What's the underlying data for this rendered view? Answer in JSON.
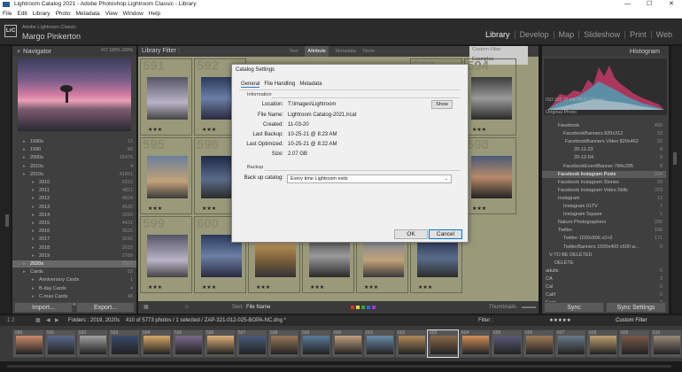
{
  "window": {
    "title": "Lightroom Catalog 2021 - Adobe Photoshop Lightroom Classic - Library",
    "minimize": "—",
    "maximize": "☐",
    "close": "✕"
  },
  "menu": [
    "File",
    "Edit",
    "Library",
    "Photo",
    "Metadata",
    "View",
    "Window",
    "Help"
  ],
  "identity": {
    "logo": "LrC",
    "app": "Adobe Lightroom Classic",
    "user": "Margo Pinkerton"
  },
  "modules": [
    "Library",
    "Develop",
    "Map",
    "Slideshow",
    "Print",
    "Web"
  ],
  "active_module": "Library",
  "navigator": {
    "title": "Navigator",
    "zoom": "FIT  100%  200%"
  },
  "folders": [
    {
      "label": "1990s",
      "count": "12"
    },
    {
      "label": "1990",
      "count": "80"
    },
    {
      "label": "2000s",
      "count": "15476"
    },
    {
      "label": "2010s",
      "count": "4"
    },
    {
      "label": "2010s",
      "count": "41691"
    },
    {
      "label": "2010",
      "count": "6313"
    },
    {
      "label": "2011",
      "count": "4811"
    },
    {
      "label": "2012",
      "count": "4824"
    },
    {
      "label": "2013",
      "count": "4530"
    },
    {
      "label": "2014",
      "count": "3260"
    },
    {
      "label": "2015",
      "count": "4431"
    },
    {
      "label": "2016",
      "count": "3625"
    },
    {
      "label": "2017",
      "count": "3242"
    },
    {
      "label": "2018",
      "count": "2615"
    },
    {
      "label": "2019",
      "count": "2780"
    },
    {
      "label": "2020s",
      "count": "2993"
    },
    {
      "label": "Cards",
      "count": "53"
    },
    {
      "label": "Anniversary Cards",
      "count": "1"
    },
    {
      "label": "B-day Cards",
      "count": "4"
    },
    {
      "label": "C-mas Cards",
      "count": "48"
    },
    {
      "label": "Combo for Social Media",
      "count": "297"
    }
  ],
  "left_buttons": {
    "import": "Import...",
    "export": "Export..."
  },
  "library_filter": {
    "label": "Library Filter :",
    "tabs": [
      "Text",
      "Attribute",
      "Metadata",
      "None"
    ],
    "active": "Attribute"
  },
  "examples": {
    "top": "Custom Filter",
    "value": "Examples"
  },
  "grid": [
    {
      "num": "591",
      "stars": "★★★"
    },
    {
      "num": "592",
      "stars": "★★★"
    },
    {
      "num": "593",
      "stars": "★★★"
    },
    {
      "num": "594",
      "stars": "★★★"
    },
    {
      "num": "595",
      "stars": "★★★"
    },
    {
      "num": "596",
      "stars": "★★★"
    },
    {
      "num": "597",
      "stars": "★★★"
    },
    {
      "num": "598",
      "stars": "★★★"
    },
    {
      "num": "599",
      "stars": "★★★"
    },
    {
      "num": "600",
      "stars": "★★★"
    },
    {
      "num": "601",
      "stars": "★★★"
    },
    {
      "num": "602",
      "stars": "★★★"
    },
    {
      "num": "603",
      "stars": "★★★"
    },
    {
      "num": "604",
      "stars": "★★★"
    },
    {
      "num": "605",
      "stars": "★★★"
    },
    {
      "num": "606",
      "stars": "★★★"
    },
    {
      "num": "607",
      "stars": "★★★"
    },
    {
      "num": "608",
      "stars": "★★★"
    }
  ],
  "toolbar": {
    "sort_label": "Sort:",
    "sort_value": "File Name",
    "thumbnails": "Thumbnails"
  },
  "histogram": {
    "title": "Histogram",
    "info": "ISO 320      10 mm      f/8.0      1/60 sec",
    "original": "Original Photo"
  },
  "keywords": [
    {
      "label": "Facebook",
      "count": "499"
    },
    {
      "label": "FacebookBanners 820x312",
      "count": "33"
    },
    {
      "label": "FacebookBanners Video 820x462",
      "count": "22"
    },
    {
      "label": "20-11-23",
      "count": "8"
    },
    {
      "label": "20-12-04",
      "count": "9"
    },
    {
      "label": "FacebookEventBanner-784x295",
      "count": "9"
    },
    {
      "label": "Facebook Instagram Posts",
      "count": "324"
    },
    {
      "label": "Facebook Instagram Stories",
      "count": "29"
    },
    {
      "label": "Facebook Instagram Video Stills",
      "count": "373"
    },
    {
      "label": "Instagram",
      "count": "13"
    },
    {
      "label": "Instagram IGTV",
      "count": "7"
    },
    {
      "label": "Instagram Square",
      "count": "1"
    },
    {
      "label": "Nature Photographers",
      "count": "200"
    },
    {
      "label": "Twitter",
      "count": "166"
    },
    {
      "label": "Twitter 1020x506 x2+2",
      "count": "171"
    },
    {
      "label": "TwitterBanners 1500x400 x500 w...",
      "count": "9"
    },
    {
      "label": "V-TO BE DELETED",
      "count": ""
    },
    {
      "label": "DELETE",
      "count": ""
    },
    {
      "label": "adults",
      "count": "6"
    },
    {
      "label": "CA",
      "count": "3"
    },
    {
      "label": "Cal",
      "count": "0"
    },
    {
      "label": "Calif",
      "count": "0"
    },
    {
      "label": "East",
      "count": "3"
    }
  ],
  "right_buttons": {
    "sync": "Sync",
    "sync_settings": "Sync Settings"
  },
  "statusbar": {
    "nums": "1  2",
    "folders": "Folders : 2019, 2020s",
    "info": "410 of 5773 photos / 1 selected / ZAP-321-012-025-BOPA-NC.dng *",
    "filter_label": "Filter :",
    "custom": "Custom Filter"
  },
  "filmstrip": [
    {
      "num": "590"
    },
    {
      "num": "591"
    },
    {
      "num": "592"
    },
    {
      "num": "593"
    },
    {
      "num": "594"
    },
    {
      "num": "595"
    },
    {
      "num": "596"
    },
    {
      "num": "597"
    },
    {
      "num": "598"
    },
    {
      "num": "599"
    },
    {
      "num": "600"
    },
    {
      "num": "601"
    },
    {
      "num": "602"
    },
    {
      "num": "603"
    },
    {
      "num": "604"
    },
    {
      "num": "605"
    },
    {
      "num": "606"
    },
    {
      "num": "607"
    },
    {
      "num": "608"
    },
    {
      "num": "609"
    },
    {
      "num": "610"
    }
  ],
  "dialog": {
    "title": "Catalog Settings",
    "tabs": [
      "General",
      "File Handling",
      "Metadata"
    ],
    "active_tab": "General",
    "info_section": "Information",
    "rows": [
      {
        "label": "Location:",
        "value": "T:\\Images\\Lightroom"
      },
      {
        "label": "File Name:",
        "value": "Lightroom Catalog-2021.lrcat"
      },
      {
        "label": "Created:",
        "value": "11-03-20"
      },
      {
        "label": "Last Backup:",
        "value": "10-25-21 @ 8:23 AM"
      },
      {
        "label": "Last Optimized:",
        "value": "10-25-21 @ 8:22 AM"
      },
      {
        "label": "Size:",
        "value": "2.07 GB"
      }
    ],
    "show_button": "Show",
    "backup_section": "Backup",
    "backup_label": "Back up catalog:",
    "backup_value": "Every time Lightroom exits",
    "ok": "OK",
    "cancel": "Cancel"
  }
}
